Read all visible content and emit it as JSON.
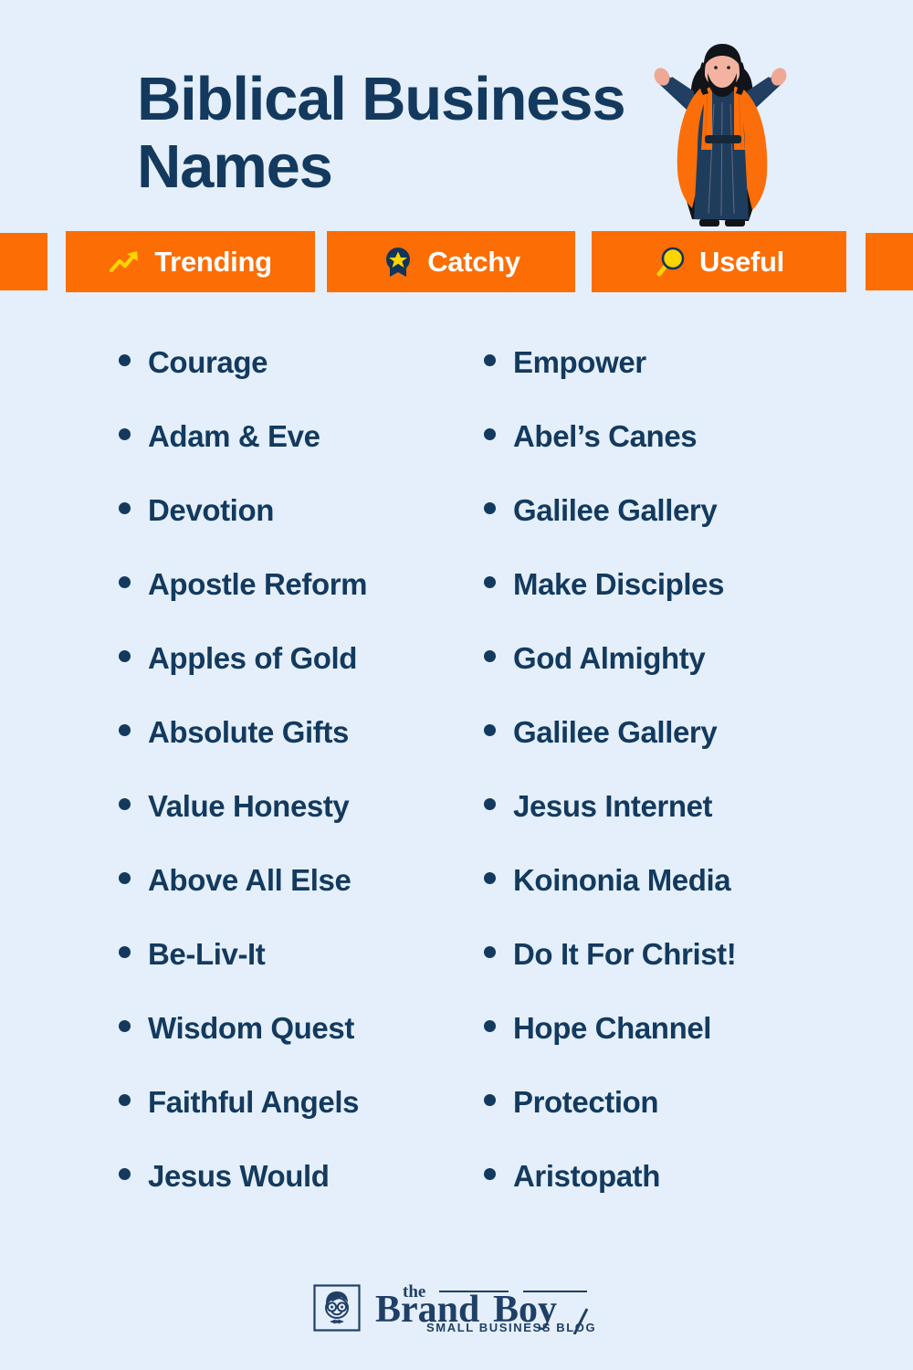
{
  "page": {
    "background_color": "#e5effc",
    "accent_color": "#fc6d04",
    "navy_color": "#133a5e",
    "star_color": "#ffd400"
  },
  "header": {
    "title": "Biblical Business\nNames",
    "illustration_name": "biblical-figure-illustration"
  },
  "badges": [
    {
      "label": "Trending",
      "icon": "trending-up-icon"
    },
    {
      "label": "Catchy",
      "icon": "award-ribbon-icon"
    },
    {
      "label": "Useful",
      "icon": "magnifying-glass-icon"
    }
  ],
  "lists": {
    "left_column": [
      "Courage",
      "Adam & Eve",
      "Devotion",
      "Apostle Reform",
      "Apples of Gold",
      "Absolute Gifts",
      "Value Honesty",
      "Above All Else",
      "Be-Liv-It",
      "Wisdom Quest",
      "Faithful Angels",
      "Jesus Would"
    ],
    "right_column": [
      "Empower",
      "Abel’s Canes",
      "Galilee Gallery",
      "Make Disciples",
      "God Almighty",
      "Galilee Gallery",
      "Jesus Internet",
      "Koinonia Media",
      "Do It For Christ!",
      "Hope Channel",
      "Protection",
      "Aristopath"
    ]
  },
  "footer": {
    "logo_the": "the",
    "logo_brand": "Brand",
    "logo_boy": "Boy",
    "logo_tagline": "SMALL BUSINESS BLOG"
  }
}
